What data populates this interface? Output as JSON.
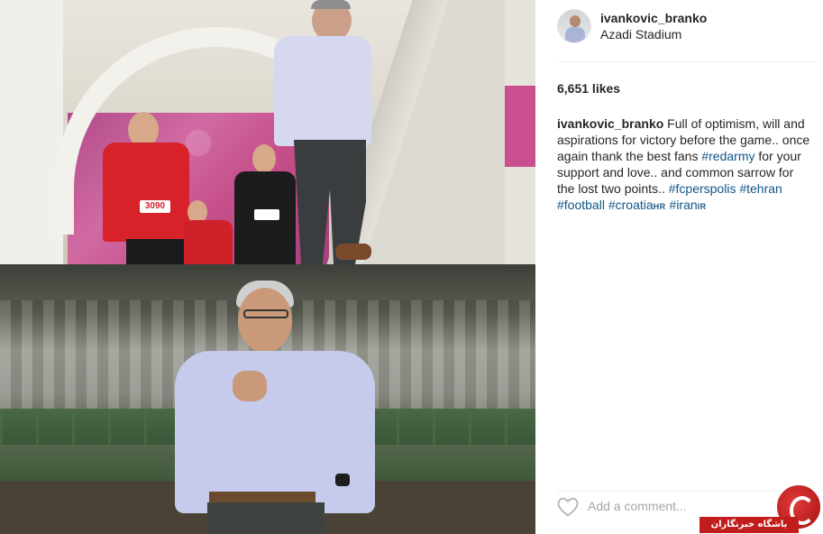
{
  "post": {
    "username": "ivankovic_branko",
    "location": "Azadi Stadium",
    "likes": "6,651 likes",
    "caption": {
      "user": "ivankovic_branko",
      "text_part1": " Full of optimism, will and aspirations for victory before the game.. once again thank the best fans ",
      "tag1": "#redarmy",
      "text_part2": " for your support and love.. and common sarrow for the lost two points.. ",
      "tag2": "#fcperspolis",
      "tag3": "#tehran",
      "tag4": "#football",
      "tag5": "#croatia",
      "tag5_suffix": "HR",
      "tag6": "#iran",
      "tag6_suffix": "IR"
    },
    "comment_placeholder": "Add a comment..."
  },
  "photos": {
    "jersey_number": "3090"
  },
  "watermark": {
    "banner_text": "باشگاه خبرنگاران"
  },
  "icons": {
    "heart": "heart-outline-icon",
    "logo": "watermark-logo-icon"
  },
  "colors": {
    "hashtag": "#125688",
    "placeholder": "#a5a7aa",
    "divider": "#efefef",
    "watermark_red": "#c21d1d"
  }
}
